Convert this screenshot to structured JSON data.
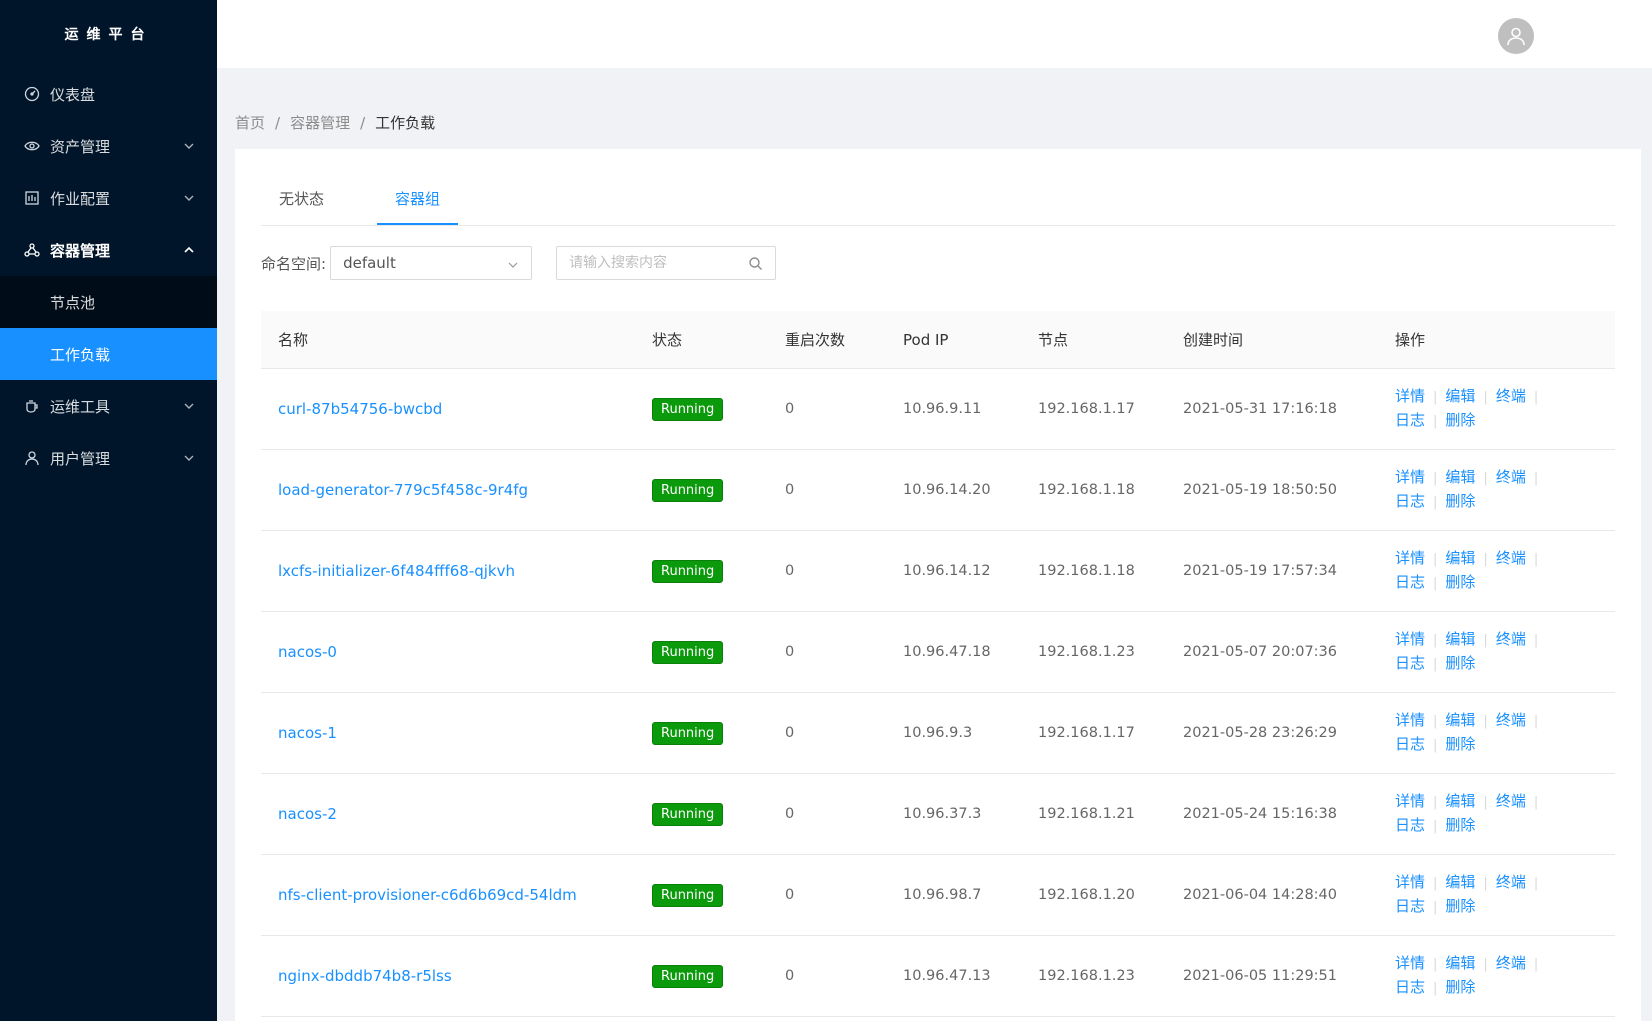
{
  "app": {
    "title": "运维平台"
  },
  "sidebar": {
    "items": [
      {
        "label": "仪表盘",
        "icon": "dashboard-icon"
      },
      {
        "label": "资产管理",
        "icon": "eye-icon"
      },
      {
        "label": "作业配置",
        "icon": "calendar-icon"
      },
      {
        "label": "容器管理",
        "icon": "cluster-icon"
      },
      {
        "label": "运维工具",
        "icon": "coffee-icon"
      },
      {
        "label": "用户管理",
        "icon": "user-icon"
      }
    ],
    "container_sub": [
      {
        "label": "节点池"
      },
      {
        "label": "工作负载"
      }
    ]
  },
  "breadcrumb": {
    "home": "首页",
    "section": "容器管理",
    "current": "工作负载",
    "sep": "/"
  },
  "tabs": [
    {
      "label": "无状态"
    },
    {
      "label": "容器组"
    }
  ],
  "filters": {
    "namespace_label": "命名空间:",
    "namespace_value": "default",
    "search_placeholder": "请输入搜索内容"
  },
  "table": {
    "headers": [
      "名称",
      "状态",
      "重启次数",
      "Pod IP",
      "节点",
      "创建时间",
      "操作"
    ],
    "actions": {
      "detail": "详情",
      "edit": "编辑",
      "terminal": "终端",
      "log": "日志",
      "delete": "删除"
    },
    "rows": [
      {
        "name": "curl-87b54756-bwcbd",
        "status": "Running",
        "restarts": "0",
        "pod_ip": "10.96.9.11",
        "node": "192.168.1.17",
        "created": "2021-05-31 17:16:18"
      },
      {
        "name": "load-generator-779c5f458c-9r4fg",
        "status": "Running",
        "restarts": "0",
        "pod_ip": "10.96.14.20",
        "node": "192.168.1.18",
        "created": "2021-05-19 18:50:50"
      },
      {
        "name": "lxcfs-initializer-6f484fff68-qjkvh",
        "status": "Running",
        "restarts": "0",
        "pod_ip": "10.96.14.12",
        "node": "192.168.1.18",
        "created": "2021-05-19 17:57:34"
      },
      {
        "name": "nacos-0",
        "status": "Running",
        "restarts": "0",
        "pod_ip": "10.96.47.18",
        "node": "192.168.1.23",
        "created": "2021-05-07 20:07:36"
      },
      {
        "name": "nacos-1",
        "status": "Running",
        "restarts": "0",
        "pod_ip": "10.96.9.3",
        "node": "192.168.1.17",
        "created": "2021-05-28 23:26:29"
      },
      {
        "name": "nacos-2",
        "status": "Running",
        "restarts": "0",
        "pod_ip": "10.96.37.3",
        "node": "192.168.1.21",
        "created": "2021-05-24 15:16:38"
      },
      {
        "name": "nfs-client-provisioner-c6d6b69cd-54ldm",
        "status": "Running",
        "restarts": "0",
        "pod_ip": "10.96.98.7",
        "node": "192.168.1.20",
        "created": "2021-06-04 14:28:40"
      },
      {
        "name": "nginx-dbddb74b8-r5lss",
        "status": "Running",
        "restarts": "0",
        "pod_ip": "10.96.47.13",
        "node": "192.168.1.23",
        "created": "2021-06-05 11:29:51"
      }
    ]
  },
  "colors": {
    "sidebar_bg": "#001529",
    "accent": "#1890ff",
    "running_badge": "#0b9a0b"
  }
}
